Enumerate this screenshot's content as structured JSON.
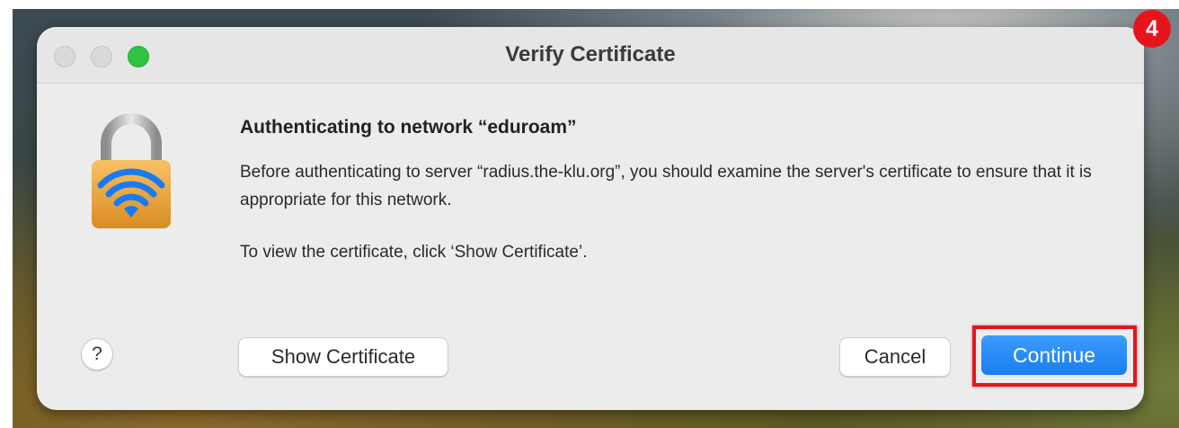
{
  "window": {
    "title": "Verify Certificate"
  },
  "dialog": {
    "heading": "Authenticating to network “eduroam”",
    "message": "Before authenticating to server “radius.the-klu.org”, you should examine the server's certificate to ensure that it is appropriate for this network.",
    "instruction": "To view the certificate, click ‘Show Certificate’.",
    "icon": "lock-wifi-icon"
  },
  "buttons": {
    "help": "?",
    "show_certificate": "Show Certificate",
    "cancel": "Cancel",
    "continue": "Continue"
  },
  "annotation": {
    "step_number": "4",
    "highlight_color": "#e8141c"
  },
  "colors": {
    "accent": "#1b7df0",
    "zoom_green": "#2fc341"
  }
}
